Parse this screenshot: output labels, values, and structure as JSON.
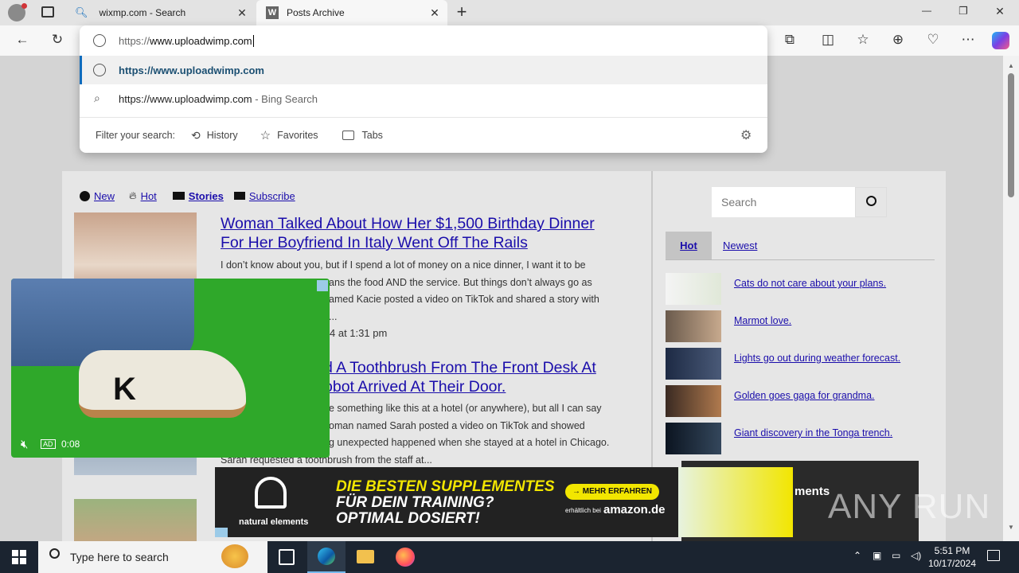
{
  "browser": {
    "tabs": [
      {
        "title": "wixmp.com - Search",
        "icon": "search-icon"
      },
      {
        "title": "Posts Archive",
        "icon": "w-site-icon"
      }
    ],
    "window_controls": {
      "minimize": "—",
      "restore": "❐",
      "close": "✕"
    }
  },
  "omnibox": {
    "value_prefix": "https://",
    "value_rest": "www.uploadwimp.com",
    "suggestions": [
      {
        "text": "https://www.uploadwimp.com",
        "icon": "globe-icon"
      },
      {
        "text": "https://www.uploadwimp.com",
        "suffix": " - Bing Search",
        "icon": "search-icon"
      }
    ],
    "filter_label": "Filter your search:",
    "filters": [
      {
        "label": "History",
        "icon": "history-icon"
      },
      {
        "label": "Favorites",
        "icon": "star-icon"
      },
      {
        "label": "Tabs",
        "icon": "tabs-icon"
      }
    ]
  },
  "site": {
    "nav": [
      {
        "label": "New",
        "icon": "clock-icon"
      },
      {
        "label": "Hot",
        "icon": "flame-icon"
      },
      {
        "label": "Stories",
        "icon": "news-icon"
      },
      {
        "label": "Subscribe",
        "icon": "mail-icon"
      }
    ],
    "posts": [
      {
        "title_line1": "Woman Talked About How Her $1,500 Birthday Dinner",
        "title_line2": "For Her Boyfriend In Italy Went Off The Rails",
        "lines": [
          "I don’t know about you, but if I spend a lot of money on a nice dinner, I want it to be",
          "ans the food AND the service. But things don’t always go as",
          "amed Kacie posted a video on TikTok and shared a story with",
          "..."
        ],
        "date": "4 at 1:31 pm"
      },
      {
        "title_line1": "d A Toothbrush From The Front Desk At",
        "title_line2": "obot Arrived At Their Door.",
        "lines": [
          "e something like this at a hotel (or anywhere), but all I can say",
          "oman named Sarah posted a video on TikTok and showed",
          "g unexpected happened when she stayed at a hotel in Chicago.",
          "Sarah requested a toothbrush from the staff at..."
        ]
      }
    ],
    "search_placeholder": "Search",
    "side_tabs": [
      {
        "label": "Hot"
      },
      {
        "label": "Newest"
      }
    ],
    "side_items": [
      {
        "label": "Cats do not care about your plans."
      },
      {
        "label": "Marmot love."
      },
      {
        "label": "Lights go out during weather forecast."
      },
      {
        "label": "Golden goes gaga for grandma."
      },
      {
        "label": "Giant discovery in the Tonga trench."
      }
    ],
    "side_ad_partial": "ments"
  },
  "video_ad": {
    "badge": "AD",
    "time": "0:08"
  },
  "banner_ad": {
    "brand": "natural elements",
    "headline1": "DIE BESTEN SUPPLEMENTES",
    "headline2": "FÜR DEIN TRAINING?",
    "headline3": "OPTIMAL DOSIERT!",
    "cta": "→ MEHR ERFAHREN",
    "available": "erhältlich bei",
    "store": "amazon.de"
  },
  "watermark": "ANY RUN",
  "taskbar": {
    "search_placeholder": "Type here to search",
    "time": "5:51 PM",
    "date": "10/17/2024"
  },
  "colors": {
    "link": "#1a0dab",
    "accent": "#0f6cbd",
    "taskbar": "#1b2430",
    "ad_green": "#2fa82a",
    "banner_yellow": "#f2e600"
  }
}
